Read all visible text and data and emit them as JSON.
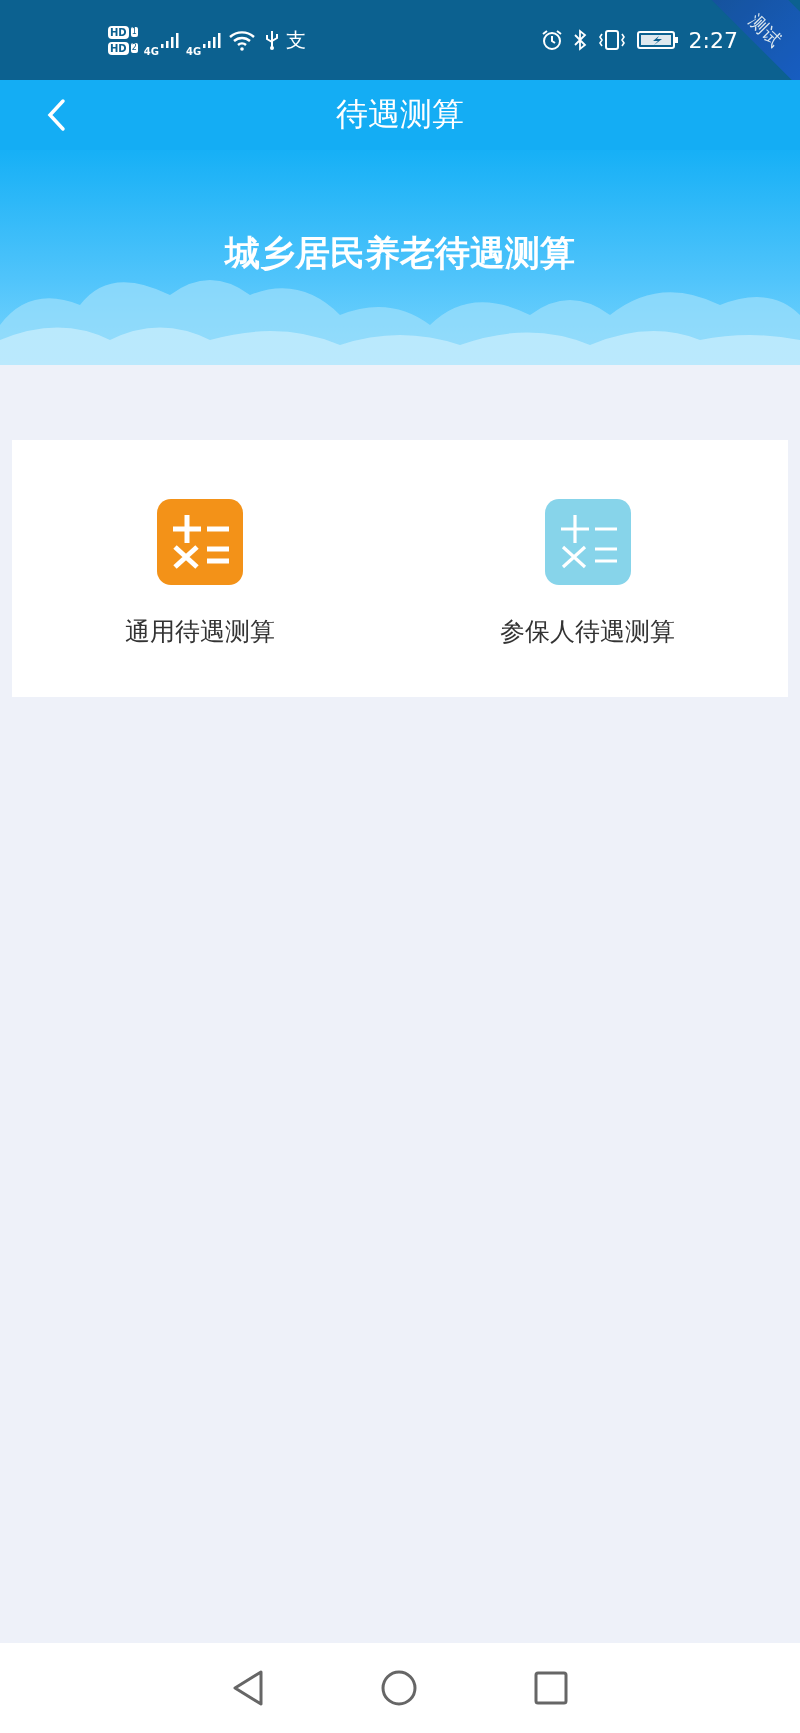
{
  "status_bar": {
    "sim_labels": [
      {
        "badge": "HD",
        "slot": "1"
      },
      {
        "badge": "HD",
        "slot": "2"
      }
    ],
    "networks": [
      "4G",
      "4G"
    ],
    "app_glyph": "支",
    "time": "2:27",
    "ribbon": "测试"
  },
  "nav_bar": {
    "title": "待遇测算"
  },
  "banner": {
    "title": "城乡居民养老待遇测算"
  },
  "options": [
    {
      "label": "通用待遇测算",
      "color": "#f39218",
      "kind": "bold"
    },
    {
      "label": "参保人待遇测算",
      "color": "#87d4ea",
      "kind": "light"
    }
  ]
}
